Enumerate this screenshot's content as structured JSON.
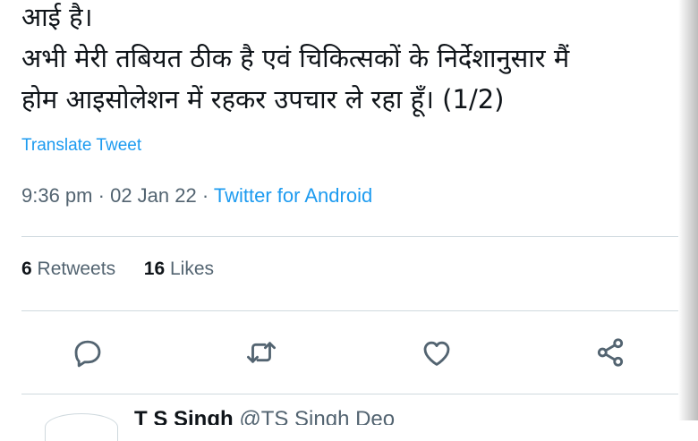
{
  "tweet": {
    "lines": [
      "आई है।",
      "अभी मेरी तबियत ठीक है एवं चिकित्सकों के निर्देशानुसार मैं",
      "होम आइसोलेशन में रहकर उपचार ले रहा हूँ। (1/2)"
    ],
    "translate_label": "Translate Tweet",
    "time": "9:36 pm",
    "date": "02 Jan 22",
    "separator": "·",
    "source": "Twitter for Android"
  },
  "stats": {
    "retweets_count": "6",
    "retweets_label": "Retweets",
    "likes_count": "16",
    "likes_label": "Likes"
  },
  "actions": {
    "icons": [
      "reply-icon",
      "retweet-icon",
      "like-icon",
      "share-icon"
    ]
  },
  "next_tweet_peek": {
    "name": "T S Singh",
    "handle": "@TS Singh Deo"
  },
  "colors": {
    "text": "#0f1419",
    "muted": "#536471",
    "link": "#1d9bf0",
    "divider": "#cfd9de"
  }
}
